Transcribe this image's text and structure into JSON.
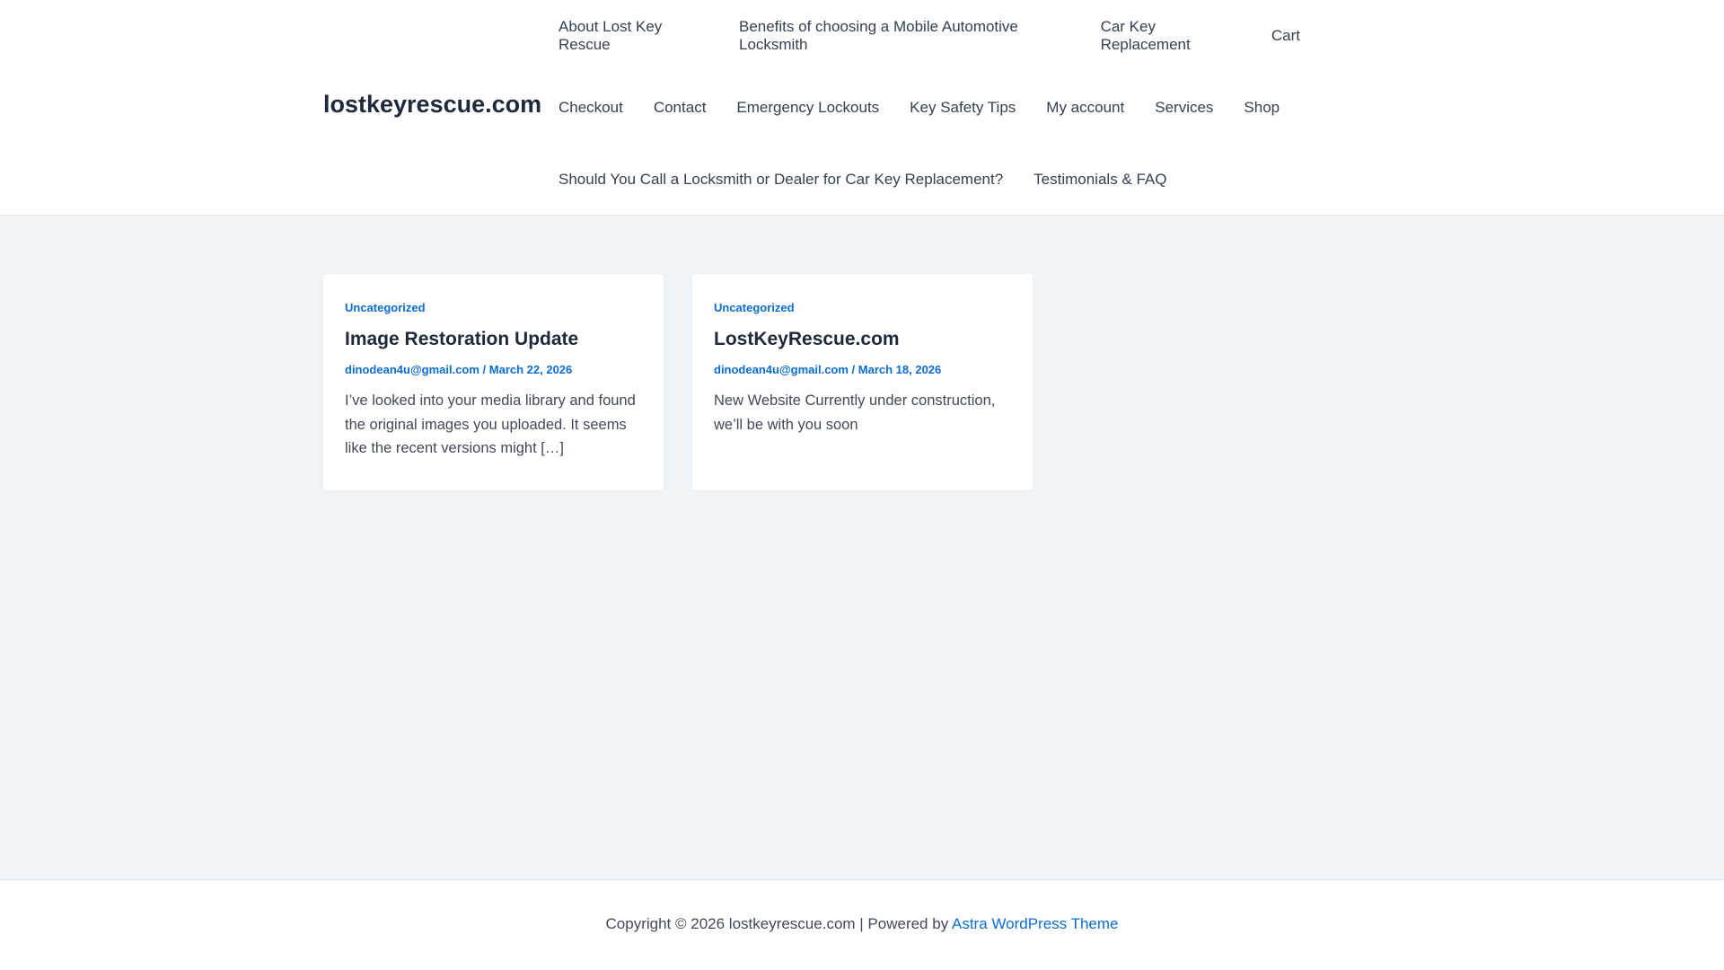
{
  "site": {
    "logo": "lostkeyrescue.com"
  },
  "nav": {
    "rows": [
      [
        "About Lost Key Rescue",
        "Benefits of choosing a Mobile Automotive Locksmith",
        "Car Key Replacement",
        "Cart"
      ],
      [
        "Checkout",
        "Contact",
        "Emergency Lockouts",
        "Key Safety Tips",
        "My account",
        "Services",
        "Shop"
      ],
      [
        "Should You Call a Locksmith or Dealer for Car Key Replacement?",
        "Testimonials & FAQ"
      ]
    ]
  },
  "posts": [
    {
      "category": "Uncategorized",
      "title": "Image Restoration Update",
      "author": "dinodean4u@gmail.com",
      "date": "March 22, 2026",
      "excerpt": "I’ve looked into your media library and found the original images you uploaded. It seems like the recent versions might […]"
    },
    {
      "category": "Uncategorized",
      "title": "LostKeyRescue.com",
      "author": "dinodean4u@gmail.com",
      "date": "March 18, 2026",
      "excerpt": "New Website Currently under construction, we’ll be with you soon"
    }
  ],
  "footer": {
    "copyright": "Copyright © 2026 lostkeyrescue.com | Powered by ",
    "link": "Astra WordPress Theme"
  },
  "meta_sep": " / "
}
